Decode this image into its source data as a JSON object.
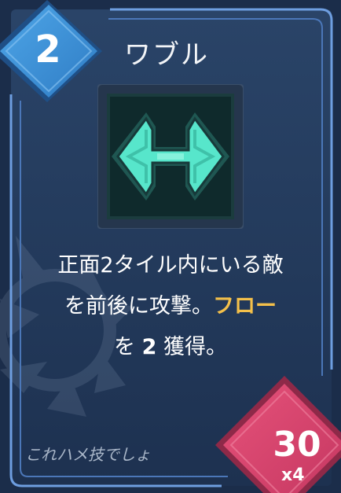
{
  "card": {
    "cost": "2",
    "title": "ワブル",
    "icon": "double-arrow-icon",
    "description": {
      "line1": "正面2タイル内にいる敵",
      "line2_pre": "を前後に攻撃。",
      "keyword": "フロー",
      "line3_pre": "を ",
      "amount": "2",
      "line3_post": " 獲得。"
    },
    "flavor": "これハメ技でしょ",
    "score": "30",
    "multiplier": "x4"
  },
  "colors": {
    "background": "#20375a",
    "border": "#6e9ee0",
    "cost_badge": "#3b8fd6",
    "score_badge": "#d9436b",
    "keyword": "#f4c04a",
    "icon": "#4fe0c4"
  }
}
